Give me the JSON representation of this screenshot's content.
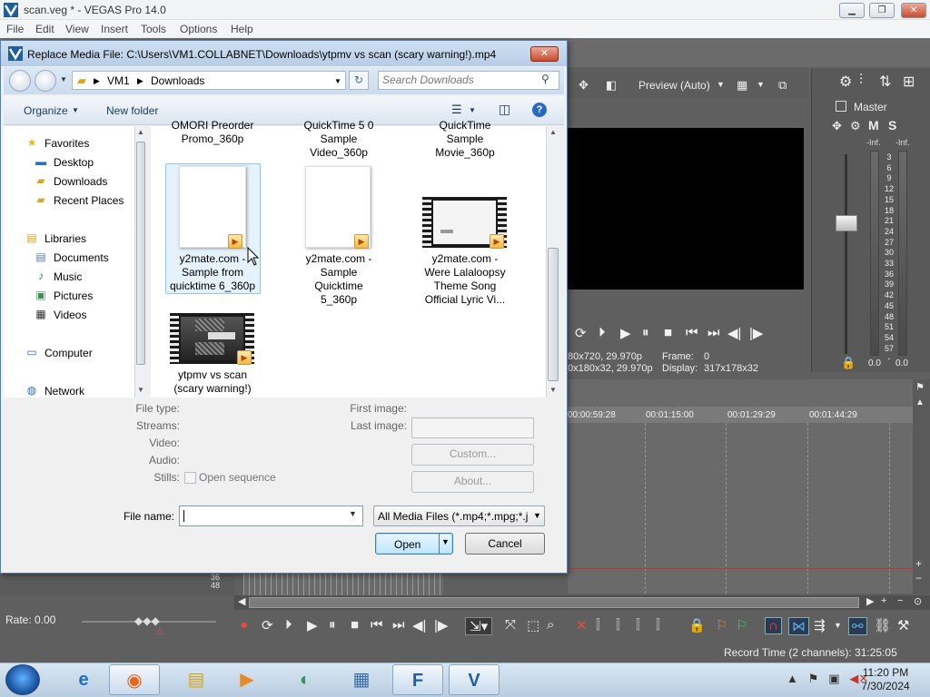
{
  "vegas": {
    "title": "scan.veg * - VEGAS Pro 14.0",
    "menu": [
      "File",
      "Edit",
      "View",
      "Insert",
      "Tools",
      "Options",
      "Help"
    ],
    "preview": {
      "mode": "Preview (Auto)",
      "info_line1_left": "80x720, 29.970p",
      "info_line2_left": "0x180x32, 29.970p",
      "frame_label": "Frame:",
      "frame_value": "0",
      "display_label": "Display:",
      "display_value": "317x178x32"
    },
    "master": {
      "label": "Master",
      "mute": "M",
      "solo": "S",
      "inf_left": "-Inf.",
      "inf_right": "-Inf.",
      "scale": [
        "3",
        "6",
        "9",
        "12",
        "15",
        "18",
        "21",
        "24",
        "27",
        "30",
        "33",
        "36",
        "39",
        "42",
        "45",
        "48",
        "51",
        "54",
        "57",
        "-"
      ],
      "value_left": "0.0",
      "value_right": "0.0"
    },
    "timeline": {
      "ruler": [
        "00:00:59:28",
        "00:01:15:00",
        "00:01:29:29",
        "00:01:44:29"
      ],
      "track_numbers": [
        "36",
        "48"
      ]
    },
    "rate_label": "Rate: 0.00",
    "record_time": "Record Time (2 channels): 31:25:05"
  },
  "dialog": {
    "title": "Replace Media File: C:\\Users\\VM1.COLLABNET\\Downloads\\ytpmv vs scan (scary warning!).mp4",
    "close": "✕",
    "breadcrumb": [
      "VM1",
      "Downloads"
    ],
    "search_placeholder": "Search Downloads",
    "organize": "Organize",
    "new_folder": "New folder",
    "nav": {
      "favorites": "Favorites",
      "desktop": "Desktop",
      "downloads": "Downloads",
      "recent": "Recent Places",
      "libraries": "Libraries",
      "documents": "Documents",
      "music": "Music",
      "pictures": "Pictures",
      "videos": "Videos",
      "computer": "Computer",
      "network": "Network"
    },
    "files": {
      "top_partial": [
        {
          "line1": "OMORI Preorder",
          "line2": "Promo_360p"
        },
        {
          "line1": "QuickTime 5 0",
          "line2": "Sample",
          "line3": "Video_360p"
        },
        {
          "line1": "QuickTime",
          "line2": "Sample",
          "line3": "Movie_360p"
        }
      ],
      "row1": [
        {
          "line1": "y2mate.com -",
          "line2": "Sample from",
          "line3": "quicktime 6_360p"
        },
        {
          "line1": "y2mate.com -",
          "line2": "Sample",
          "line3": "Quicktime",
          "line4": "5_360p"
        },
        {
          "line1": "y2mate.com -",
          "line2": "Were Lalaloopsy",
          "line3": "Theme Song",
          "line4": "Official Lyric Vi..."
        }
      ],
      "row2": [
        {
          "line1": "ytpmv vs scan",
          "line2": "(scary warning!)"
        }
      ]
    },
    "details": {
      "file_type": "File type:",
      "streams": "Streams:",
      "video": "Video:",
      "audio": "Audio:",
      "stills": "Stills:",
      "open_sequence": "Open sequence",
      "first_image": "First image:",
      "last_image": "Last image:",
      "custom": "Custom...",
      "about": "About..."
    },
    "file_name_label": "File name:",
    "file_name_value": "",
    "filter": "All Media Files (*.mp4;*.mpg;*.j",
    "open": "Open",
    "cancel": "Cancel"
  },
  "taskbar": {
    "time": "11:20 PM",
    "date": "7/30/2024"
  }
}
